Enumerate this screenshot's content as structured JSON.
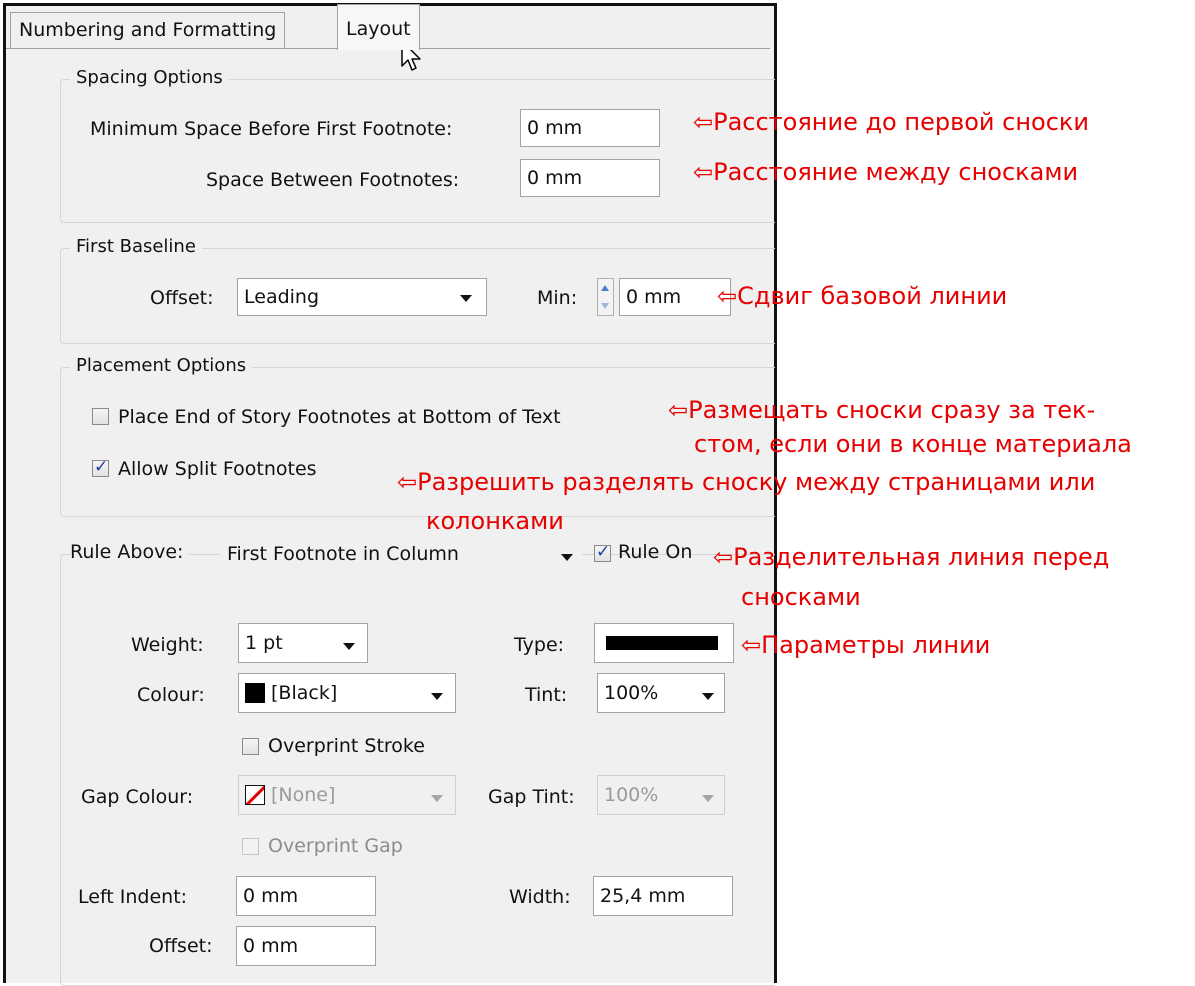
{
  "tabs": {
    "numbering": "Numbering and Formatting",
    "layout": "Layout"
  },
  "spacing": {
    "legend": "Spacing Options",
    "min_space_label": "Minimum Space Before First Footnote:",
    "min_space_value": "0 mm",
    "between_label": "Space Between Footnotes:",
    "between_value": "0 mm"
  },
  "baseline": {
    "legend": "First Baseline",
    "offset_label": "Offset:",
    "offset_value": "Leading",
    "min_label": "Min:",
    "min_value": "0 mm"
  },
  "placement": {
    "legend": "Placement Options",
    "end_of_story_label": "Place End of Story Footnotes at Bottom of Text",
    "end_of_story_checked": false,
    "allow_split_label": "Allow Split Footnotes",
    "allow_split_checked": true
  },
  "rule": {
    "above_label": "Rule Above:",
    "above_value": "First Footnote in Column",
    "rule_on_label": "Rule On",
    "rule_on_checked": true,
    "weight_label": "Weight:",
    "weight_value": "1 pt",
    "type_label": "Type:",
    "colour_label": "Colour:",
    "colour_value": "[Black]",
    "tint_label": "Tint:",
    "tint_value": "100%",
    "overprint_stroke_label": "Overprint Stroke",
    "gap_colour_label": "Gap Colour:",
    "gap_colour_value": "[None]",
    "gap_tint_label": "Gap Tint:",
    "gap_tint_value": "100%",
    "overprint_gap_label": "Overprint Gap",
    "left_indent_label": "Left Indent:",
    "left_indent_value": "0 mm",
    "width_label": "Width:",
    "width_value": "25,4 mm",
    "offset_label": "Offset:",
    "offset_value": "0 mm"
  },
  "annotations": {
    "a1": "⇦Расстояние до первой сноски",
    "a2": "⇦Расстояние между сносками",
    "a3": "⇦Сдвиг базовой линии",
    "a4_line1": "⇦Размещать сноски сразу за тек-",
    "a4_line2": "стом, если они в конце материала",
    "a5_line1": "⇦Разрешить разделять сноску между страницами или",
    "a5_line2": "колонками",
    "a6_line1": "⇦Разделительная линия перед",
    "a6_line2": "сносками",
    "a7": "⇦Параметры линии"
  },
  "colors": {
    "annotation": "#e60000",
    "dialog_bg": "#f0f0f0",
    "checkmark": "#1a3f9a"
  }
}
